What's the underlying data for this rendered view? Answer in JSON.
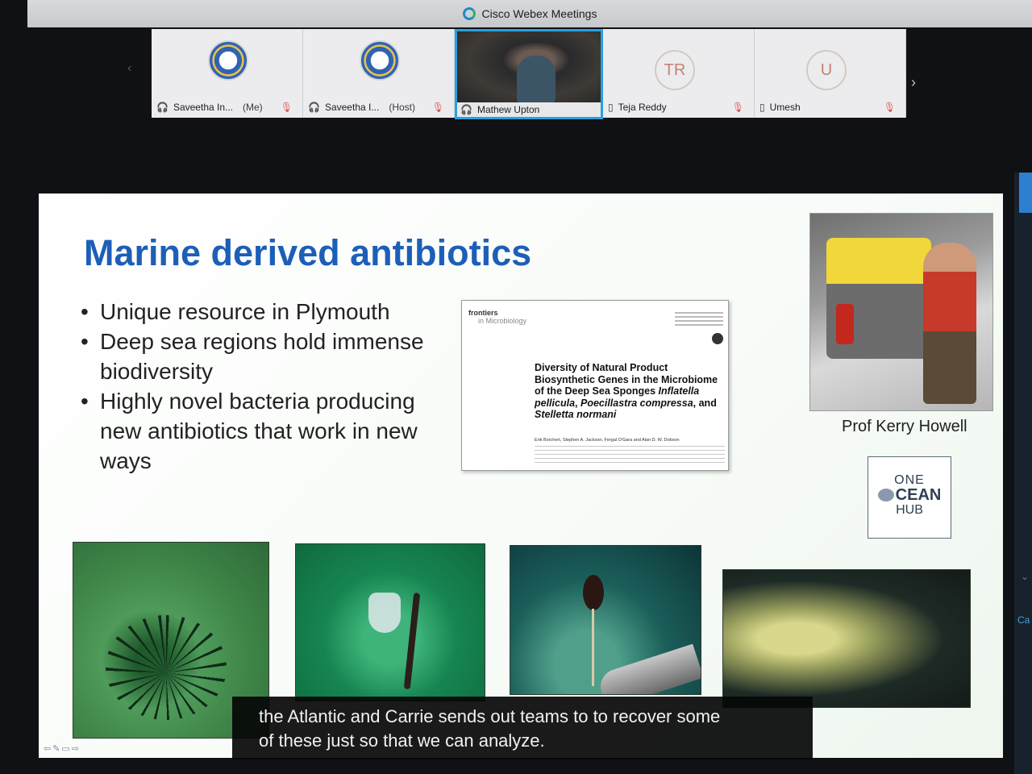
{
  "window": {
    "title": "Cisco Webex Meetings"
  },
  "participants": [
    {
      "name": "Saveetha In...",
      "tag": "(Me)"
    },
    {
      "name": "Saveetha I...",
      "tag": "(Host)"
    },
    {
      "name": "Mathew Upton",
      "tag": ""
    },
    {
      "name": "Teja Reddy",
      "tag": "",
      "initials": "TR"
    },
    {
      "name": "Umesh",
      "tag": "",
      "initials": "U"
    }
  ],
  "slide": {
    "title": "Marine derived antibiotics",
    "bullets": [
      "Unique resource in Plymouth",
      "Deep sea regions hold immense biodiversity",
      "Highly novel bacteria producing new antibiotics that work in new ways"
    ],
    "paper": {
      "journal": "frontiers",
      "journal_sub": "in Microbiology",
      "title_part1": "Diversity of Natural Product Biosynthetic Genes in the Microbiome of the Deep Sea Sponges ",
      "title_species1": "Inflatella pellicula",
      "title_part2": ", ",
      "title_species2": "Poecillastra compressa",
      "title_part3": ", and ",
      "title_species3": "Stelletta normani",
      "authors": "Erik Borchert, Stephen A. Jackson, Fergal O'Gara and Alan D. W. Dobson"
    },
    "photo_caption": "Prof Kerry Howell",
    "logo": {
      "line1": "ONE",
      "line2": "CEAN",
      "line3": "HUB"
    }
  },
  "subtitles": {
    "line1": "the Atlantic and Carrie sends out teams to to recover some",
    "line2": "of these just so that we can analyze."
  },
  "sidebar": {
    "partial_label": "Ca"
  }
}
